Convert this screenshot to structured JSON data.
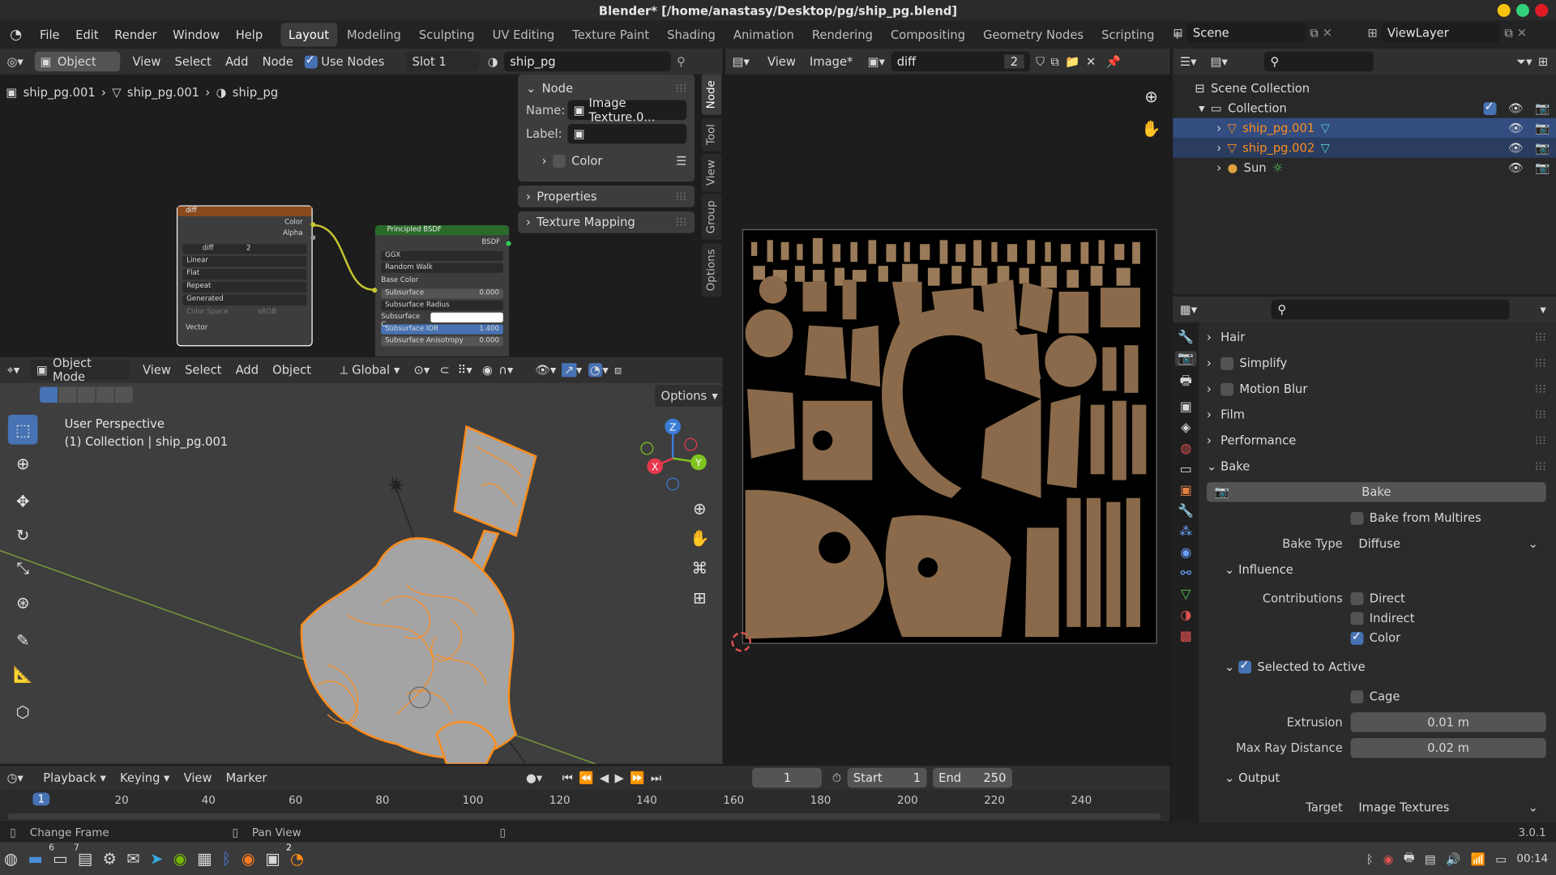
{
  "app": {
    "title": "Blender* [/home/anastasy/Desktop/pg/ship_pg.blend]",
    "version": "3.0.1"
  },
  "menus": [
    "File",
    "Edit",
    "Render",
    "Window",
    "Help"
  ],
  "workspaces": [
    "Layout",
    "Modeling",
    "Sculpting",
    "UV Editing",
    "Texture Paint",
    "Shading",
    "Animation",
    "Rendering",
    "Compositing",
    "Geometry Nodes",
    "Scripting"
  ],
  "scene": {
    "name": "Scene",
    "viewlayer": "ViewLayer"
  },
  "node_editor": {
    "mode": "Object",
    "view": "View",
    "select": "Select",
    "add": "Add",
    "node": "Node",
    "use_nodes": "Use Nodes",
    "slot": "Slot 1",
    "material": "ship_pg",
    "breadcrumb": [
      "ship_pg.001",
      "ship_pg.001",
      "ship_pg"
    ],
    "tex_node": {
      "title": "diff",
      "out_color": "Color",
      "out_alpha": "Alpha",
      "img": "diff",
      "users": "2",
      "interp": "Linear",
      "proj": "Flat",
      "ext": "Repeat",
      "src": "Generated",
      "cs_label": "Color Space",
      "cs": "sRGB",
      "vector": "Vector"
    },
    "bsdf": {
      "title": "Principled BSDF",
      "out": "BSDF",
      "dist": "GGX",
      "sss": "Random Walk",
      "base": "Base Color",
      "subsurface": "Subsurface",
      "subsurface_val": "0.000",
      "radius": "Subsurface Radius",
      "subc": "Subsurface C...",
      "ior": "Subsurface IOR",
      "ior_val": "1.400",
      "aniso": "Subsurface Anisotropy",
      "aniso_val": "0.000"
    },
    "sidebar": {
      "node": "Node",
      "name_label": "Name:",
      "name": "Image Texture.0...",
      "label_label": "Label:",
      "color": "Color",
      "properties": "Properties",
      "tex_mapping": "Texture Mapping",
      "tabs": [
        "Node",
        "Tool",
        "View",
        "Group",
        "Options"
      ]
    }
  },
  "viewport": {
    "mode": "Object Mode",
    "view": "View",
    "select": "Select",
    "add": "Add",
    "object": "Object",
    "orient": "Global",
    "options": "Options",
    "persp": "User Perspective",
    "coll": "(1) Collection | ship_pg.001",
    "axes": {
      "x": "X",
      "y": "Y",
      "z": "Z"
    }
  },
  "image_editor": {
    "view": "View",
    "image": "Image*",
    "name": "diff",
    "users": "2"
  },
  "outliner": {
    "items": [
      {
        "name": "Scene Collection"
      },
      {
        "name": "Collection"
      },
      {
        "name": "ship_pg.001"
      },
      {
        "name": "ship_pg.002"
      },
      {
        "name": "Sun"
      }
    ]
  },
  "properties": {
    "sections": [
      "Hair",
      "Simplify",
      "Motion Blur",
      "Film",
      "Performance",
      "Bake"
    ],
    "bake_btn": "Bake",
    "multires": "Bake from Multires",
    "bake_type_label": "Bake Type",
    "bake_type": "Diffuse",
    "influence": "Influence",
    "contrib": "Contributions",
    "direct": "Direct",
    "indirect": "Indirect",
    "color": "Color",
    "sel_active": "Selected to Active",
    "cage": "Cage",
    "extrusion_label": "Extrusion",
    "extrusion": "0.01 m",
    "ray_label": "Max Ray Distance",
    "ray": "0.02 m",
    "output": "Output",
    "target_label": "Target",
    "target": "Image Textures"
  },
  "timeline": {
    "playback": "Playback",
    "keying": "Keying",
    "view": "View",
    "marker": "Marker",
    "frame": "1",
    "start_label": "Start",
    "start": "1",
    "end_label": "End",
    "end": "250",
    "current": "1",
    "ticks": [
      "20",
      "40",
      "60",
      "80",
      "100",
      "120",
      "140",
      "160",
      "180",
      "200",
      "220",
      "240"
    ]
  },
  "status": {
    "change_frame": "Change Frame",
    "pan_view": "Pan View"
  },
  "taskbar": {
    "badge1": "6",
    "badge2": "7",
    "badge3": "2",
    "time": "00:14"
  },
  "colors": {
    "accent": "#4772b3",
    "select": "#ff8c1a",
    "node_header_tex": "#8a4a1e",
    "node_header_bsdf": "#2c6a2c",
    "selected_row": "#334d80"
  }
}
